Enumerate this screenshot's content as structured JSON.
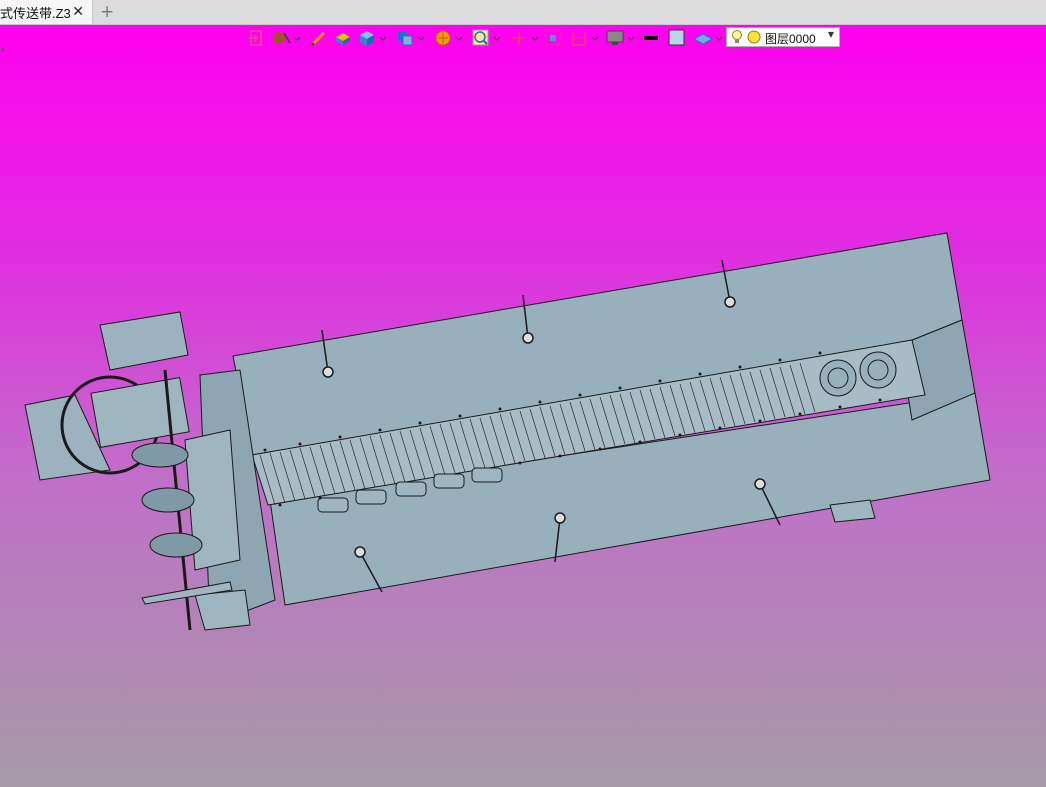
{
  "tab": {
    "title": "式传送带.Z3",
    "close_glyph": "✕",
    "add_glyph": "+"
  },
  "toolbar": {
    "icons": [
      "exit-sketch-icon",
      "pick-filter-icon",
      "pen-icon",
      "solid-icon",
      "cube-icon",
      "view-cube-icon",
      "render-style-icon",
      "zoom-icon",
      "axis-icon",
      "frame-icon",
      "section-icon",
      "display-icon",
      "line-color-icon",
      "fill-color-icon",
      "layer-plane-icon"
    ],
    "layer": {
      "name": "图层0000"
    }
  },
  "colors": {
    "viewport_top": "#ff00f0",
    "viewport_bottom": "#a69aa6",
    "model_body": "#98b0bc",
    "model_edge": "#1a1a1a"
  }
}
